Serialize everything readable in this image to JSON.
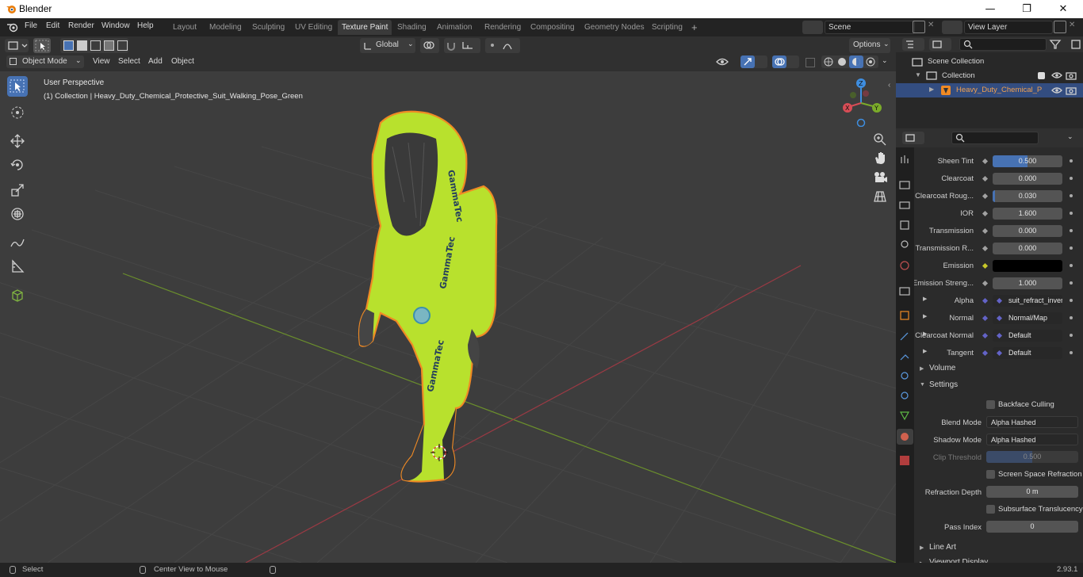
{
  "window": {
    "title": "Blender",
    "minimize": "—",
    "maximize": "❐",
    "close": "✕"
  },
  "menu": [
    "File",
    "Edit",
    "Render",
    "Window",
    "Help"
  ],
  "workspaces": [
    "Layout",
    "Modeling",
    "Sculpting",
    "UV Editing",
    "Texture Paint",
    "Shading",
    "Animation",
    "Rendering",
    "Compositing",
    "Geometry Nodes",
    "Scripting"
  ],
  "active_workspace": "Texture Paint",
  "scene": {
    "name": "Scene",
    "view_layer": "View Layer"
  },
  "header": {
    "transform": "Global",
    "options": "Options",
    "mode": "Object Mode",
    "menus": [
      "View",
      "Select",
      "Add",
      "Object"
    ]
  },
  "viewport": {
    "perspective": "User Perspective",
    "collection_info": "(1) Collection | Heavy_Duty_Chemical_Protective_Suit_Walking_Pose_Green",
    "suit_brand": "GammaTec"
  },
  "gizmo": {
    "x": "X",
    "y": "Y",
    "z": "Z"
  },
  "outliner": {
    "scene_collection": "Scene Collection",
    "collection": "Collection",
    "object": "Heavy_Duty_Chemical_P"
  },
  "properties": {
    "rows": [
      {
        "label": "Sheen Tint",
        "value": "0.500",
        "fill": 0.5,
        "kind": "slider"
      },
      {
        "label": "Clearcoat",
        "value": "0.000",
        "fill": 0,
        "kind": "slider"
      },
      {
        "label": "Clearcoat Roug...",
        "value": "0.030",
        "fill": 0.03,
        "kind": "slider"
      },
      {
        "label": "IOR",
        "value": "1.600",
        "fill": 0,
        "kind": "slider"
      },
      {
        "label": "Transmission",
        "value": "0.000",
        "fill": 0,
        "kind": "slider"
      },
      {
        "label": "Transmission R...",
        "value": "0.000",
        "fill": 0,
        "kind": "slider"
      },
      {
        "label": "Emission",
        "value": "",
        "fill": 0,
        "kind": "color"
      },
      {
        "label": "Emission Streng...",
        "value": "1.000",
        "fill": 0,
        "kind": "slider"
      },
      {
        "label": "Alpha",
        "value": "suit_refract_invert.pn",
        "fill": 0,
        "kind": "link"
      },
      {
        "label": "Normal",
        "value": "Normal/Map",
        "fill": 0,
        "kind": "link"
      },
      {
        "label": "Clearcoat Normal",
        "value": "Default",
        "fill": 0,
        "kind": "link"
      },
      {
        "label": "Tangent",
        "value": "Default",
        "fill": 0,
        "kind": "link"
      }
    ],
    "volume_panel": "Volume",
    "settings_panel": "Settings",
    "backface_culling": "Backface Culling",
    "blend_mode_label": "Blend Mode",
    "blend_mode": "Alpha Hashed",
    "shadow_mode_label": "Shadow Mode",
    "shadow_mode": "Alpha Hashed",
    "clip_threshold_label": "Clip Threshold",
    "clip_threshold": "0.500",
    "screen_space_refraction": "Screen Space Refraction",
    "refraction_depth_label": "Refraction Depth",
    "refraction_depth": "0 m",
    "subsurface_translucency": "Subsurface Translucency",
    "pass_index_label": "Pass Index",
    "pass_index": "0",
    "line_art_panel": "Line Art",
    "viewport_display_panel": "Viewport Display"
  },
  "status": {
    "select": "Select",
    "center_view": "Center View to Mouse",
    "version": "2.93.1"
  },
  "colors": {
    "accent": "#4772b3",
    "selected_outline": "#f08a24",
    "suit": "#b5e02c",
    "x_axis": "#d84d56",
    "y_axis": "#7bab2a",
    "z_axis": "#3e8ee0"
  }
}
